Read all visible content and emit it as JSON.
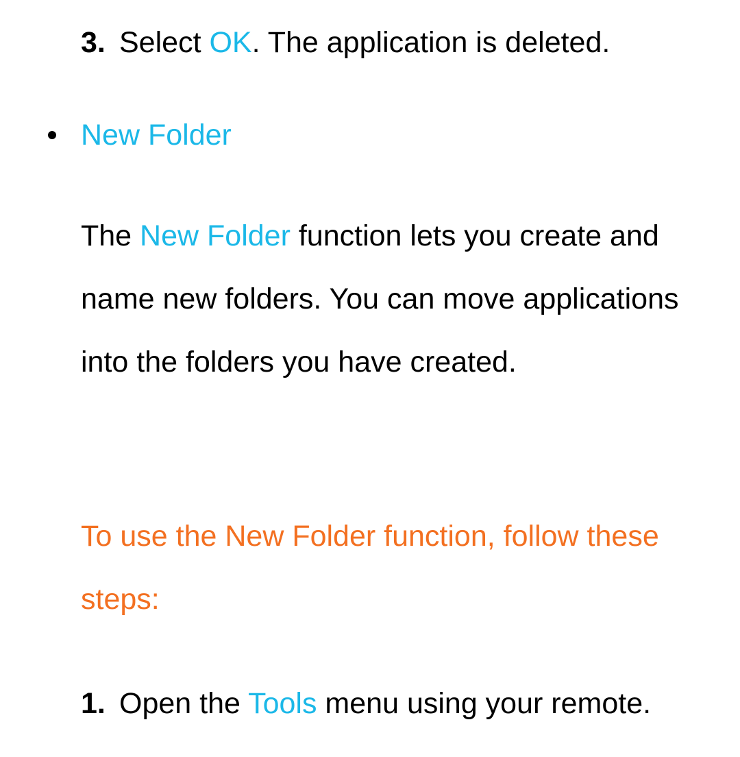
{
  "step3": {
    "num": "3.",
    "t1": "Select ",
    "ok": "OK",
    "t2": ". The application is deleted."
  },
  "bullet": {
    "title": "New Folder"
  },
  "desc": {
    "t1": "The ",
    "nf": "New Folder",
    "t2": " function lets you create and name new folders. You can move applications into the folders you have created."
  },
  "heading": {
    "text": "To use the New Folder function, follow these steps:"
  },
  "step1": {
    "num": "1.",
    "t1": "Open the ",
    "tools": "Tools",
    "t2": " menu using your remote."
  }
}
